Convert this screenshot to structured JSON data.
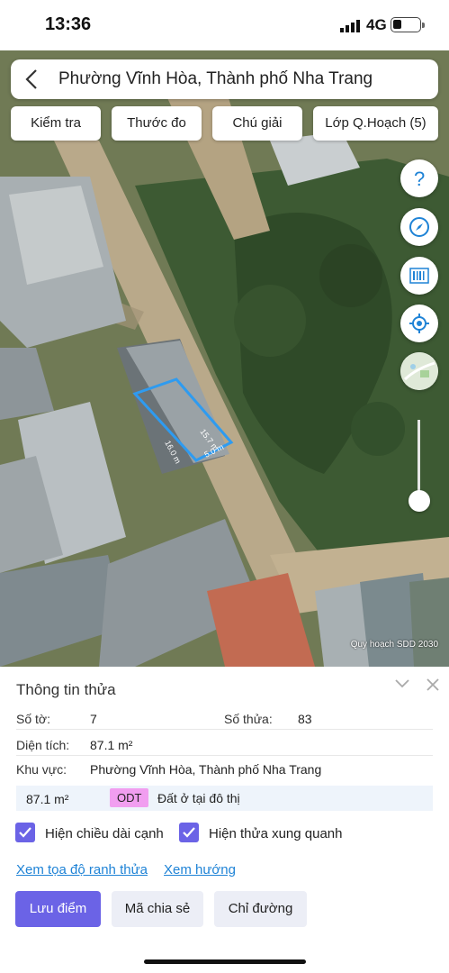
{
  "status": {
    "time": "13:36",
    "network": "4G"
  },
  "header": {
    "title": "Phường Vĩnh Hòa, Thành phố Nha Trang"
  },
  "toolbar": {
    "check": "Kiểm tra",
    "measure": "Thước đo",
    "legend": "Chú giải",
    "layer": "Lớp Q.Hoạch (5)"
  },
  "map": {
    "edge_labels": [
      "16.0 m",
      "15.7 m",
      "5.0 m"
    ],
    "attribution": "Quy hoạch SDD 2030",
    "zoom_level": 0.1,
    "parcel_color": "#2e9bf0"
  },
  "panel": {
    "title": "Thông tin thửa",
    "sheet_label": "Số tờ:",
    "sheet_value": "7",
    "parcel_label": "Số thửa:",
    "parcel_value": "83",
    "area_label": "Diện tích:",
    "area_value": "87.1 m²",
    "region_label": "Khu vực:",
    "region_value": "Phường Vĩnh Hòa, Thành phố Nha Trang",
    "land_area": "87.1 m²",
    "land_code": "ODT",
    "land_desc": "Đất ở tại đô thị",
    "show_edges": "Hiện chiều dài cạnh",
    "show_neighbors": "Hiện thửa xung quanh",
    "link_coords": "Xem tọa độ ranh thửa",
    "link_direction": "Xem hướng",
    "btn_save": "Lưu điểm",
    "btn_share": "Mã chia sẻ",
    "btn_route": "Chỉ đường"
  },
  "colors": {
    "accent": "#6b63e6",
    "link": "#1f83d6",
    "tag": "#f19ef0"
  }
}
